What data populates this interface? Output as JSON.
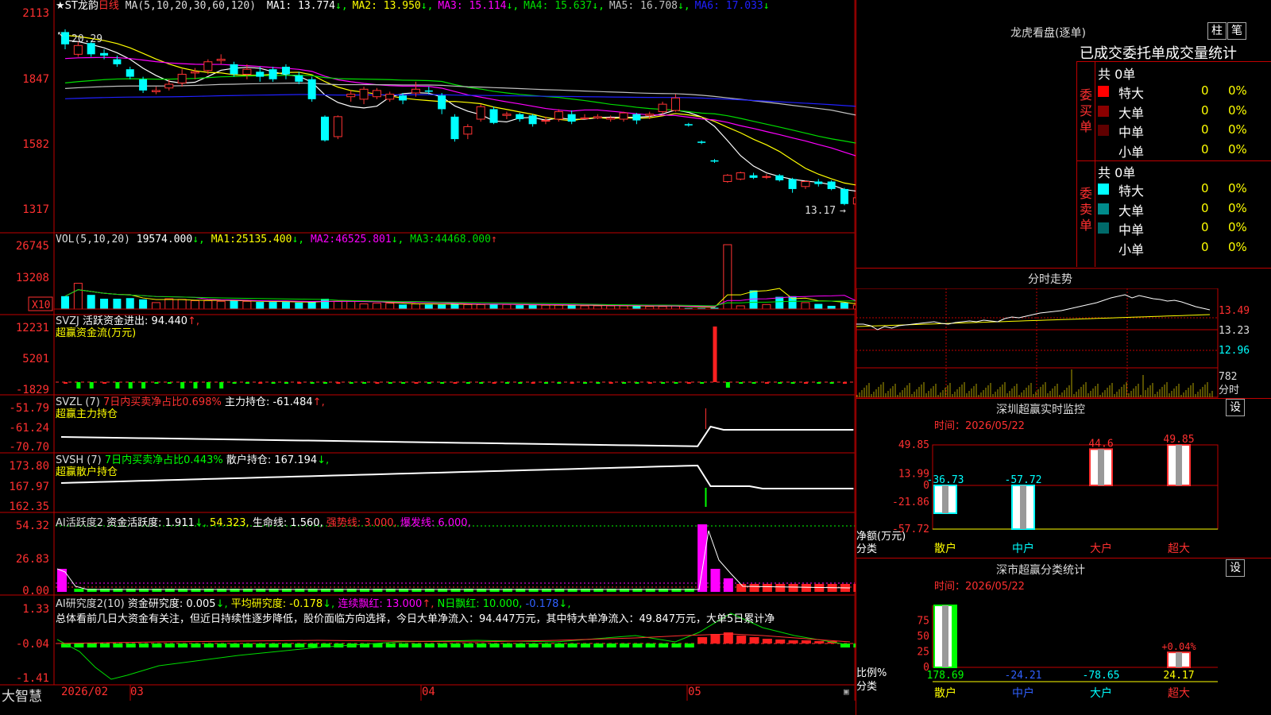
{
  "colors": {
    "up": "#ff3333",
    "down": "#00ffff",
    "grid": "#c00000",
    "axis": "#ff3030",
    "ma1": "#ffffff",
    "ma2": "#ffff00",
    "ma3": "#ff00ff",
    "ma4": "#00dd00",
    "ma5": "#c0c0c0",
    "ma6": "#2020ff",
    "green": "#00ff00",
    "magenta": "#ff00ff",
    "yellow": "#ffff00"
  },
  "header": {
    "stock_name": "★ST龙韵",
    "period": "日线",
    "ma_label": "MA(5,10,20,30,60,120)",
    "ma_items": [
      {
        "label": "MA1:",
        "value": "13.774",
        "arrow": "↓",
        "color": "#ffffff"
      },
      {
        "label": "MA2:",
        "value": "13.950",
        "arrow": "↓",
        "color": "#ffff00"
      },
      {
        "label": "MA3:",
        "value": "15.114",
        "arrow": "↓",
        "color": "#ff00ff"
      },
      {
        "label": "MA4:",
        "value": "15.637",
        "arrow": "↓",
        "color": "#00dd00"
      },
      {
        "label": "MA5:",
        "value": "16.708",
        "arrow": "↓",
        "color": "#c0c0c0"
      },
      {
        "label": "MA6:",
        "value": "17.033",
        "arrow": "↓",
        "color": "#2020ff"
      }
    ]
  },
  "chart_data": [
    {
      "type": "candlestick",
      "title": "★ST龙韵 日线",
      "y_ticks": [
        "2113",
        "1847",
        "1582",
        "1317"
      ],
      "ylim": [
        13.0,
        21.13
      ],
      "annotations": [
        "20.29",
        "13.17"
      ],
      "candles": [
        [
          20.29,
          19.8,
          20.4,
          19.6
        ],
        [
          19.4,
          19.75,
          19.9,
          19.3
        ],
        [
          19.85,
          19.4,
          19.95,
          19.3
        ],
        [
          19.45,
          19.35,
          19.6,
          19.2
        ],
        [
          19.2,
          19.0,
          19.35,
          18.9
        ],
        [
          18.8,
          18.5,
          18.9,
          18.4
        ],
        [
          18.4,
          17.95,
          18.5,
          17.85
        ],
        [
          17.9,
          17.95,
          18.1,
          17.8
        ],
        [
          18.05,
          18.2,
          18.4,
          17.95
        ],
        [
          18.25,
          18.6,
          18.8,
          18.1
        ],
        [
          18.65,
          18.7,
          18.85,
          18.4
        ],
        [
          18.75,
          19.1,
          19.2,
          18.6
        ],
        [
          19.15,
          19.2,
          19.4,
          19.0
        ],
        [
          19.0,
          18.6,
          19.1,
          18.5
        ],
        [
          18.6,
          18.8,
          19.0,
          18.4
        ],
        [
          18.7,
          18.5,
          18.9,
          18.3
        ],
        [
          18.8,
          18.4,
          18.9,
          18.3
        ],
        [
          18.9,
          18.6,
          19.0,
          18.4
        ],
        [
          18.55,
          18.3,
          18.7,
          18.2
        ],
        [
          18.4,
          17.6,
          18.5,
          17.5
        ],
        [
          16.9,
          15.95,
          16.95,
          15.9
        ],
        [
          16.1,
          16.9,
          16.95,
          16.0
        ],
        [
          17.7,
          17.8,
          17.95,
          17.5
        ],
        [
          17.6,
          18.0,
          18.1,
          17.4
        ],
        [
          17.7,
          17.95,
          18.05,
          17.6
        ],
        [
          17.6,
          17.8,
          17.9,
          17.5
        ],
        [
          17.75,
          17.55,
          17.85,
          17.4
        ],
        [
          17.85,
          18.0,
          18.3,
          17.7
        ],
        [
          17.95,
          17.9,
          18.1,
          17.8
        ],
        [
          17.75,
          17.2,
          17.85,
          17.0
        ],
        [
          16.9,
          16.0,
          17.0,
          15.9
        ],
        [
          16.2,
          16.5,
          16.6,
          16.0
        ],
        [
          16.8,
          17.3,
          17.4,
          16.7
        ],
        [
          17.2,
          16.65,
          17.3,
          16.6
        ],
        [
          16.95,
          17.0,
          17.1,
          16.8
        ],
        [
          17.0,
          16.8,
          17.05,
          16.7
        ],
        [
          16.95,
          16.6,
          17.0,
          16.5
        ],
        [
          16.75,
          16.75,
          16.9,
          16.6
        ],
        [
          16.8,
          17.1,
          17.2,
          16.7
        ],
        [
          17.0,
          16.7,
          17.15,
          16.6
        ],
        [
          16.85,
          16.85,
          17.0,
          16.8
        ],
        [
          16.85,
          16.9,
          17.0,
          16.8
        ],
        [
          16.8,
          16.85,
          16.95,
          16.7
        ],
        [
          16.8,
          17.05,
          17.1,
          16.7
        ],
        [
          17.0,
          16.75,
          17.05,
          16.6
        ],
        [
          16.95,
          17.0,
          17.1,
          16.8
        ],
        [
          17.1,
          17.4,
          17.5,
          17.0
        ],
        [
          17.15,
          17.65,
          17.8,
          17.1
        ],
        [
          16.6,
          16.55,
          16.65,
          16.5
        ],
        [
          15.9,
          15.85,
          15.95,
          15.8
        ],
        [
          15.15,
          15.1,
          15.2,
          15.05
        ],
        [
          14.3,
          14.55,
          14.6,
          14.25
        ],
        [
          14.4,
          14.65,
          14.7,
          14.35
        ],
        [
          14.55,
          14.45,
          14.65,
          14.4
        ],
        [
          14.5,
          14.5,
          14.6,
          14.4
        ],
        [
          14.55,
          14.35,
          14.6,
          14.3
        ],
        [
          14.4,
          14.0,
          14.45,
          13.85
        ],
        [
          14.1,
          14.3,
          14.35,
          14.0
        ],
        [
          14.3,
          14.2,
          14.4,
          14.1
        ],
        [
          14.3,
          14.0,
          14.35,
          13.95
        ],
        [
          14.0,
          13.4,
          14.05,
          13.35
        ],
        [
          13.4,
          13.65,
          13.7,
          13.2
        ]
      ]
    },
    {
      "type": "bar",
      "title": "VOL(5,10,20)",
      "y_ticks": [
        "26745",
        "13208",
        "X10"
      ],
      "values_text": [
        "19574.000",
        "25135.400",
        "46525.801",
        "44468.000"
      ]
    },
    {
      "type": "bar",
      "title": "SVZJ",
      "y_ticks": [
        "12231",
        "5201",
        "-1829"
      ]
    },
    {
      "type": "line",
      "title": "SVZL (7)",
      "y_ticks": [
        "-51.79",
        "-61.24",
        "-70.70"
      ]
    },
    {
      "type": "line",
      "title": "SVSH (7)",
      "y_ticks": [
        "173.80",
        "167.97",
        "162.35"
      ]
    },
    {
      "type": "bar",
      "title": "AI活跃度2",
      "y_ticks": [
        "54.32",
        "26.83",
        "0.00"
      ]
    },
    {
      "type": "line",
      "title": "AI研究度2(10)",
      "y_ticks": [
        "1.33",
        "-0.04",
        "-1.41"
      ]
    }
  ],
  "vol_pane": {
    "label": "VOL(5,10,20)",
    "value": "19574.000",
    "ma1_label": "MA1:",
    "ma1": "25135.400",
    "ma2_label": "MA2:",
    "ma2": "46525.801",
    "ma3_label": "MA3:",
    "ma3": "44468.000",
    "x10": "X10"
  },
  "svzj_pane": {
    "label": "SVZJ",
    "text": "活跃资金进出: 94.440",
    "arrow": "↑,",
    "sub": "超赢资金流(万元)"
  },
  "svzl_pane": {
    "label": "SVZL (7)",
    "text1": "7日内买卖净占比0.698%",
    "text2": "主力持仓: -61.484",
    "arrow": "↑,",
    "sub": "超赢主力持仓"
  },
  "svsh_pane": {
    "label": "SVSH (7)",
    "text1": "7日内买卖净占比0.443%",
    "text2": "散户持仓: 167.194",
    "arrow": "↓,",
    "sub": "超赢散户持仓"
  },
  "ai_active_pane": {
    "label": "AI活跃度2",
    "t1": "资金活跃度: 1.911",
    "a1": "↓,",
    "t2": "54.323,",
    "t3": "生命线: 1.560,",
    "t4": "强势线: 3.000,",
    "t5": "爆发线: 6.000,"
  },
  "ai_research_pane": {
    "label": "AI研究度2(10)",
    "t1": "资金研究度: 0.005",
    "a1": "↓,",
    "t2": "平均研究度: -0.178",
    "a2": "↓,",
    "t3": "连续飘红: 13.000",
    "a3": "↑,",
    "t4": "N日飘红: 10.000,",
    "t5": "-0.178",
    "a5": "↓,",
    "summary": "总体看前几日大资金有关注，但近日持续性逐步降低，股价面临方向选择，今日大单净流入：94.447万元，其中特大单净流入：49.847万元，大单5日累计净"
  },
  "footer": {
    "brand": "大智慧",
    "dates": [
      "2026/02",
      "03",
      "04",
      "05"
    ]
  },
  "dragon_panel": {
    "title": "龙虎看盘(逐单)",
    "btn1": "柱",
    "btn2": "笔",
    "subtitle": "已成交委托单成交量统计",
    "buy_total": "共 0单",
    "sell_total": "共 0单",
    "buy_label": "委买单",
    "sell_label": "委卖单",
    "buy_rows": [
      {
        "name": "特大",
        "count": "0",
        "pct": "0%",
        "color": "#ff0000"
      },
      {
        "name": "大单",
        "count": "0",
        "pct": "0%",
        "color": "#8b0000"
      },
      {
        "name": "中单",
        "count": "0",
        "pct": "0%",
        "color": "#600000"
      },
      {
        "name": "小单",
        "count": "0",
        "pct": "0%",
        "color": ""
      }
    ],
    "sell_rows": [
      {
        "name": "特大",
        "count": "0",
        "pct": "0%",
        "color": "#00ffff"
      },
      {
        "name": "大单",
        "count": "0",
        "pct": "0%",
        "color": "#008b8b"
      },
      {
        "name": "中单",
        "count": "0",
        "pct": "0%",
        "color": "#006a6a"
      },
      {
        "name": "小单",
        "count": "0",
        "pct": "0%",
        "color": ""
      }
    ]
  },
  "intraday": {
    "title": "分时走势",
    "prices": [
      "13.49",
      "13.23",
      "12.96"
    ],
    "vol": "782",
    "vol_unit": "分时"
  },
  "sz_monitor": {
    "title": "深圳超赢实时监控",
    "btn": "设",
    "time": "时间：2026/05/22",
    "y_ticks": [
      "49.85",
      "13.99",
      "0",
      "-21.86",
      "-57.72"
    ],
    "ylabel1": "净额(万元)",
    "ylabel2": "分类",
    "categories": [
      "散户",
      "中户",
      "大户",
      "超大"
    ],
    "values": [
      -36.73,
      -57.72,
      44.6,
      49.85
    ],
    "value_labels": [
      "-36.73",
      "-57.72",
      "44.6",
      "49.85"
    ]
  },
  "sz_classify": {
    "title": "深市超赢分类统计",
    "btn": "设",
    "time": "时间：2026/05/22",
    "y_ticks": [
      "75",
      "50",
      "25",
      "0"
    ],
    "ylabel1": "比例%",
    "ylabel2": "分类",
    "categories": [
      "散户",
      "中户",
      "大户",
      "超大"
    ],
    "values": [
      178.69,
      -24.21,
      -78.65,
      24.17
    ],
    "value_labels": [
      "178.69",
      "-24.21",
      "-78.65",
      "24.17"
    ],
    "extra_label": "+0.04%"
  }
}
